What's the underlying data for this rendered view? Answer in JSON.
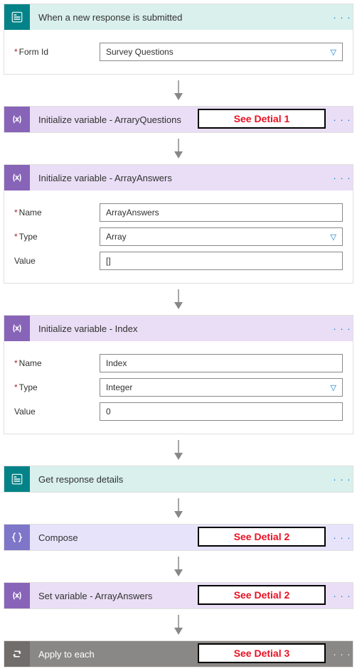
{
  "steps": {
    "trigger": {
      "title": "When a new response is submitted"
    },
    "formId": {
      "label": "Form Id",
      "value": "Survey Questions"
    },
    "initQuestions": {
      "title": "Initialize variable - ArraryQuestions",
      "badge": "See Detial 1"
    },
    "initAnswers": {
      "title": "Initialize variable - ArrayAnswers",
      "name_label": "Name",
      "name_value": "ArrayAnswers",
      "type_label": "Type",
      "type_value": "Array",
      "value_label": "Value",
      "value_value": "[]"
    },
    "initIndex": {
      "title": "Initialize variable - Index",
      "name_label": "Name",
      "name_value": "Index",
      "type_label": "Type",
      "type_value": "Integer",
      "value_label": "Value",
      "value_value": "0"
    },
    "getResponse": {
      "title": "Get response details"
    },
    "compose": {
      "title": "Compose",
      "badge": "See Detial 2"
    },
    "setVar": {
      "title": "Set variable - ArrayAnswers",
      "badge": "See Detial 2"
    },
    "applyEach": {
      "title": "Apply to each",
      "badge": "See Detial 3"
    }
  },
  "ui": {
    "more": "· · ·"
  }
}
